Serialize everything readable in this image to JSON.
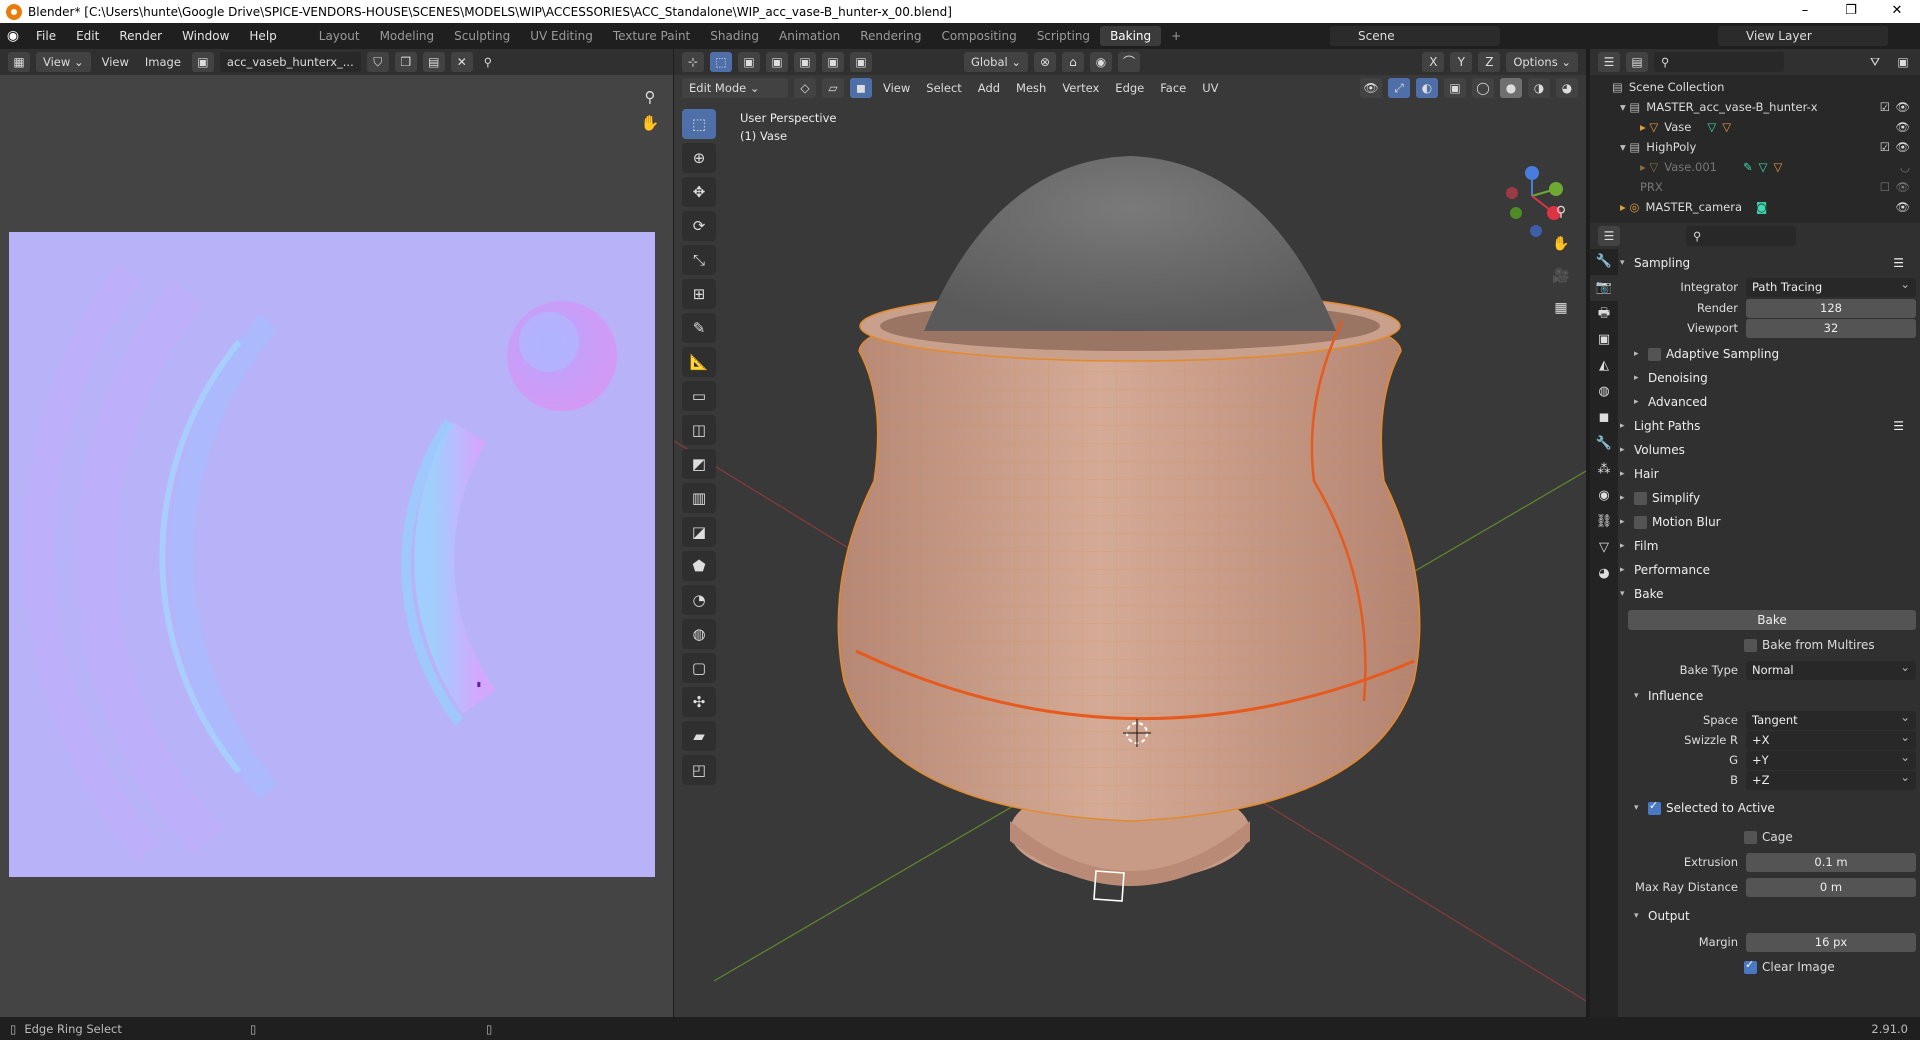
{
  "window": {
    "title": "Blender* [C:\\Users\\hunte\\Google Drive\\SPICE-VENDORS-HOUSE\\SCENES\\MODELS\\WIP\\ACCESSORIES\\ACC_Standalone\\WIP_acc_vase-B_hunter-x_00.blend]",
    "minimize": "–",
    "maximize": "❐",
    "close": "✕"
  },
  "menu": [
    "File",
    "Edit",
    "Render",
    "Window",
    "Help"
  ],
  "workspaces": [
    "Layout",
    "Modeling",
    "Sculpting",
    "UV Editing",
    "Texture Paint",
    "Shading",
    "Animation",
    "Rendering",
    "Compositing",
    "Scripting",
    "Baking",
    "+"
  ],
  "active_workspace": "Baking",
  "scene": "Scene",
  "view_layer": "View Layer",
  "image_editor": {
    "view_menu": "View",
    "menus": [
      "View",
      "Image"
    ],
    "image_name": "acc_vaseb_hunterx_..."
  },
  "viewport": {
    "orientation": "Global",
    "options": "Options",
    "mode": "Edit Mode",
    "menus": [
      "View",
      "Select",
      "Add",
      "Mesh",
      "Vertex",
      "Edge",
      "Face",
      "UV"
    ],
    "label_line1": "User Perspective",
    "label_line2": "(1) Vase",
    "axes": {
      "x": "X",
      "y": "Y",
      "z": "Z"
    },
    "colors": {
      "mesh": "#c79b85",
      "edge_select": "#ff8800",
      "seam": "#e65a1e",
      "red_axis": "#a3343e",
      "green_axis": "#6a9432"
    }
  },
  "outliner": {
    "root": "Scene Collection",
    "items": [
      {
        "name": "MASTER_acc_vase-B_hunter-x",
        "indent": 1
      },
      {
        "name": "Vase",
        "indent": 2
      },
      {
        "name": "HighPoly",
        "indent": 1
      },
      {
        "name": "Vase.001",
        "indent": 2
      },
      {
        "name": "PRX",
        "indent": 1
      },
      {
        "name": "MASTER_camera",
        "indent": 1
      }
    ]
  },
  "properties": {
    "sampling": "Sampling",
    "integrator_label": "Integrator",
    "integrator": "Path Tracing",
    "render_label": "Render",
    "render": "128",
    "viewport_label": "Viewport",
    "viewport": "32",
    "adaptive_sampling": "Adaptive Sampling",
    "denoising": "Denoising",
    "advanced": "Advanced",
    "sections": [
      "Light Paths",
      "Volumes",
      "Hair",
      "Simplify",
      "Motion Blur",
      "Film",
      "Performance",
      "Bake"
    ],
    "bake_button": "Bake",
    "bake_from_multires": "Bake from Multires",
    "bake_type_label": "Bake Type",
    "bake_type": "Normal",
    "influence": "Influence",
    "space_label": "Space",
    "space": "Tangent",
    "swizzle_r_label": "Swizzle R",
    "swizzle_r": "+X",
    "g_label": "G",
    "g": "+Y",
    "b_label": "B",
    "b": "+Z",
    "selected_to_active": "Selected to Active",
    "cage": "Cage",
    "extrusion_label": "Extrusion",
    "extrusion": "0.1 m",
    "max_ray_label": "Max Ray Distance",
    "max_ray": "0 m",
    "output": "Output",
    "margin_label": "Margin",
    "margin": "16 px",
    "clear_image": "Clear Image"
  },
  "status": {
    "left": "Edge Ring Select",
    "version": "2.91.0"
  }
}
